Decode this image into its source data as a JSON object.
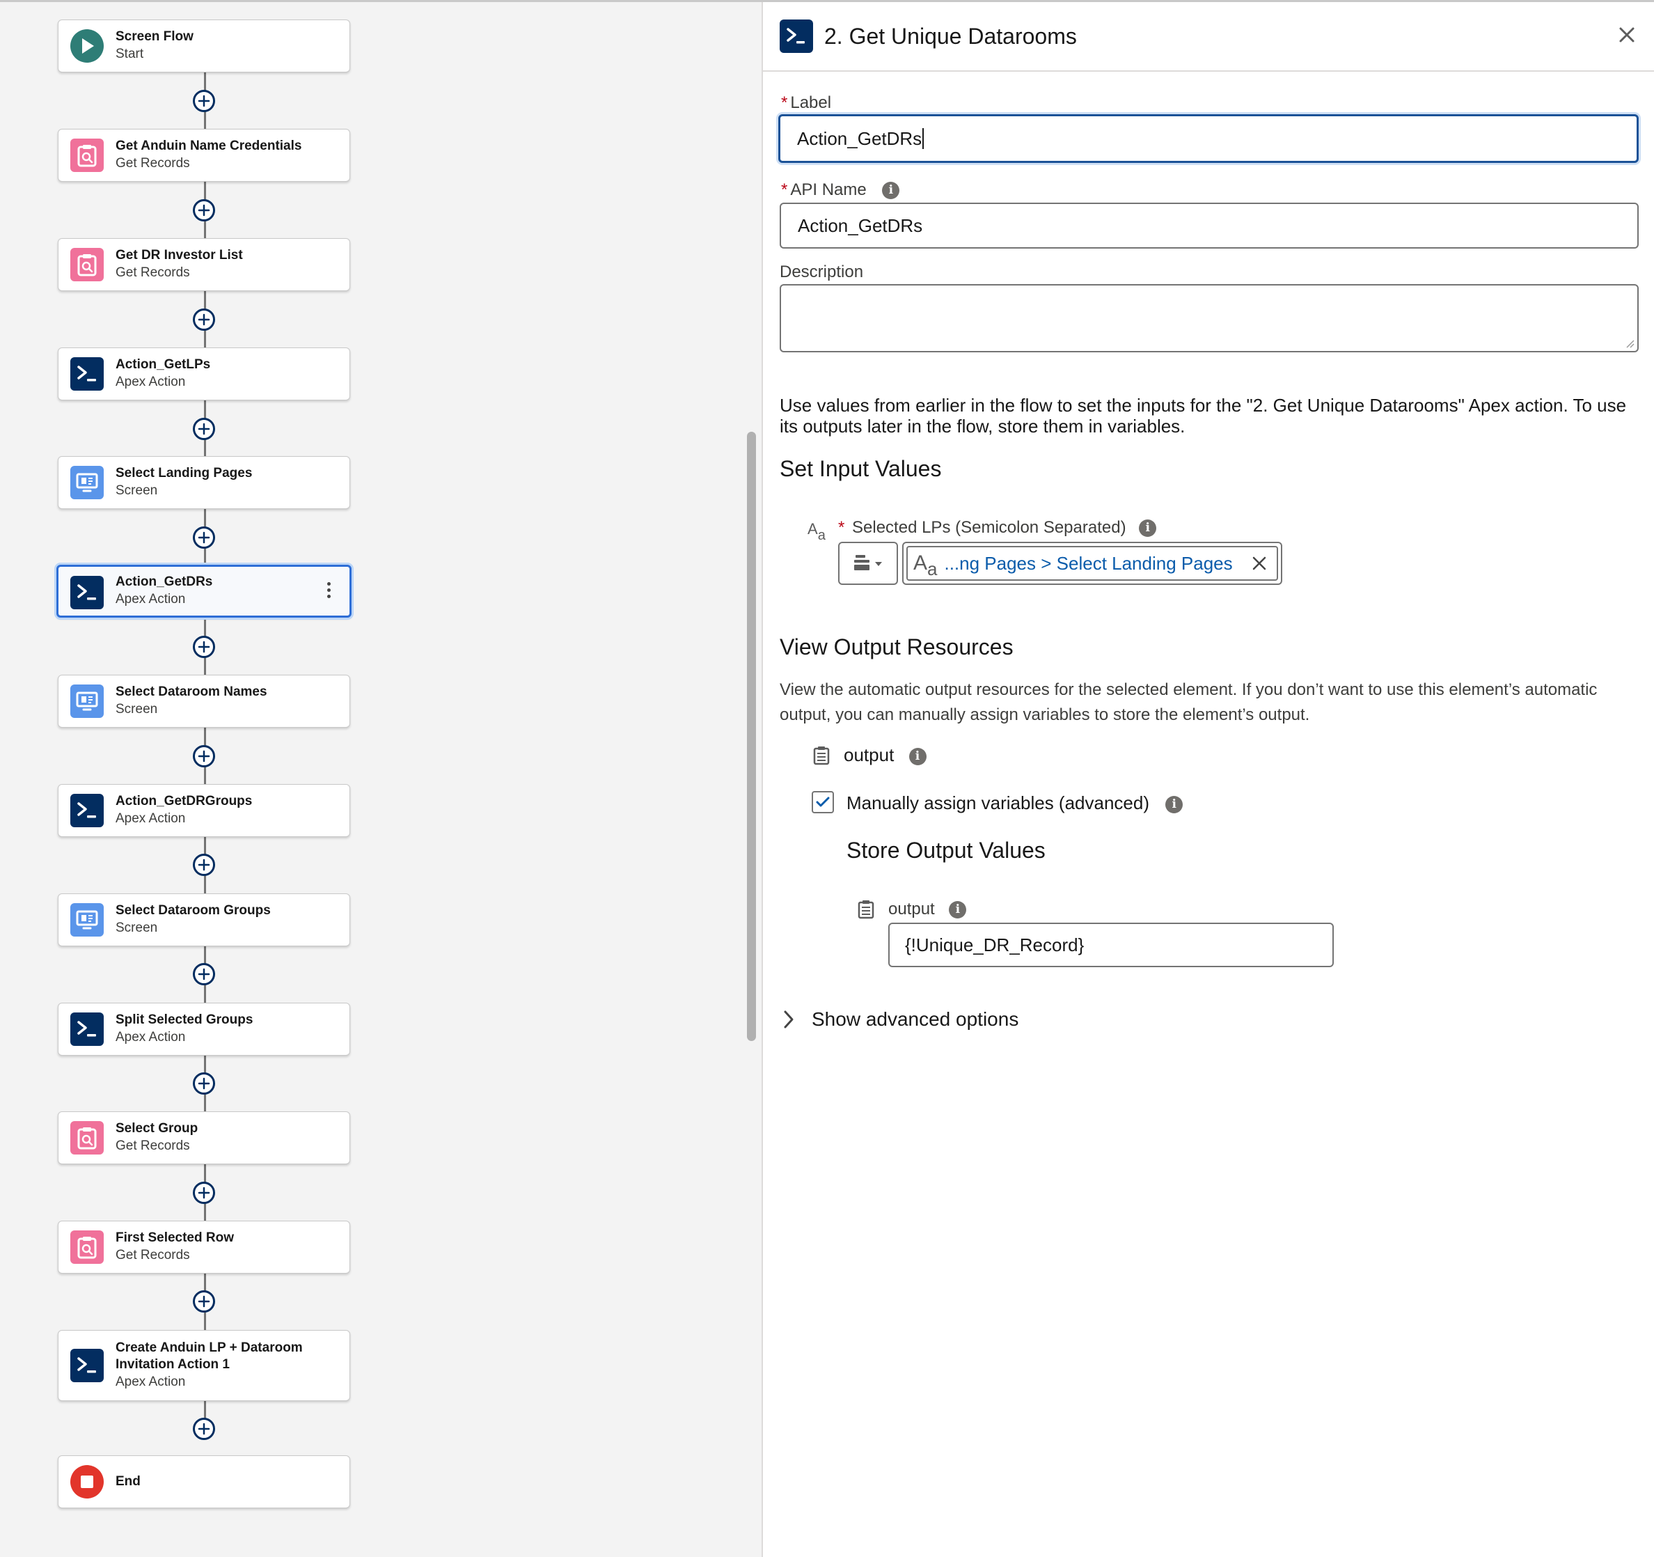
{
  "flow": {
    "nodes": [
      {
        "title": "Screen Flow",
        "subtitle": "Start",
        "icon": "play-icon",
        "kind": "start"
      },
      {
        "title": "Get Anduin Name Credentials",
        "subtitle": "Get Records",
        "icon": "get-records-icon",
        "kind": "records"
      },
      {
        "title": "Get DR Investor List",
        "subtitle": "Get Records",
        "icon": "get-records-icon",
        "kind": "records"
      },
      {
        "title": "Action_GetLPs",
        "subtitle": "Apex Action",
        "icon": "apex-action-icon",
        "kind": "apex"
      },
      {
        "title": "Select Landing Pages",
        "subtitle": "Screen",
        "icon": "screen-icon",
        "kind": "screen"
      },
      {
        "title": "Action_GetDRs",
        "subtitle": "Apex Action",
        "icon": "apex-action-icon",
        "kind": "apex",
        "selected": true
      },
      {
        "title": "Select Dataroom Names",
        "subtitle": "Screen",
        "icon": "screen-icon",
        "kind": "screen"
      },
      {
        "title": "Action_GetDRGroups",
        "subtitle": "Apex Action",
        "icon": "apex-action-icon",
        "kind": "apex"
      },
      {
        "title": "Select Dataroom Groups",
        "subtitle": "Screen",
        "icon": "screen-icon",
        "kind": "screen"
      },
      {
        "title": "Split Selected Groups",
        "subtitle": "Apex Action",
        "icon": "apex-action-icon",
        "kind": "apex"
      },
      {
        "title": "Select Group",
        "subtitle": "Get Records",
        "icon": "get-records-icon",
        "kind": "records"
      },
      {
        "title": "First Selected Row",
        "subtitle": "Get Records",
        "icon": "get-records-icon",
        "kind": "records"
      },
      {
        "title": "Create Anduin LP + Dataroom Invitation Action 1",
        "subtitle": "Apex Action",
        "icon": "apex-action-icon",
        "kind": "apex"
      },
      {
        "title": "End",
        "subtitle": "",
        "icon": "stop-icon",
        "kind": "end"
      }
    ]
  },
  "panel": {
    "title": "2. Get Unique Datarooms",
    "label_field": {
      "label": "Label",
      "value": "Action_GetDRs"
    },
    "api_name_field": {
      "label": "API Name",
      "value": "Action_GetDRs"
    },
    "description_field": {
      "label": "Description",
      "value": ""
    },
    "intro_text": "Use values from earlier in the flow to set the inputs for the \"2. Get Unique Datarooms\" Apex action. To use its outputs later in the flow, store them in variables.",
    "set_input_heading": "Set Input Values",
    "input_param": {
      "label": "Selected LPs (Semicolon Separated)",
      "value": "...ng Pages > Select Landing Pages"
    },
    "view_output_heading": "View Output Resources",
    "view_output_text": "View the automatic output resources for the selected element. If you don’t want to use this element’s automatic output, you can manually assign variables to store the element’s output.",
    "output_resource": "output",
    "manual_assign_label": "Manually assign variables (advanced)",
    "manual_assign_checked": true,
    "store_output_heading": "Store Output Values",
    "store_output": {
      "label": "output",
      "value": "{!Unique_DR_Record}"
    },
    "advanced_toggle": "Show advanced options"
  },
  "colors": {
    "accent": "#032d60",
    "focus": "#1b5297",
    "link": "#0b5cab"
  }
}
